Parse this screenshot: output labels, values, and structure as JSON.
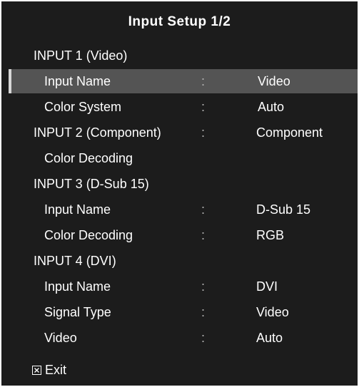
{
  "title": "Input Setup 1/2",
  "colon": ":",
  "rows": [
    {
      "label": "INPUT 1 (Video)",
      "value": ""
    },
    {
      "label": "Input Name",
      "value": "Video"
    },
    {
      "label": "Color System",
      "value": "Auto"
    },
    {
      "label": "INPUT 2 (Component)",
      "value": "Component"
    },
    {
      "label": "Color Decoding",
      "value": ""
    },
    {
      "label": "INPUT 3 (D-Sub 15)",
      "value": ""
    },
    {
      "label": "Input Name",
      "value": "D-Sub 15"
    },
    {
      "label": "Color Decoding",
      "value": "RGB"
    },
    {
      "label": "INPUT 4 (DVI)",
      "value": ""
    },
    {
      "label": "Input Name",
      "value": "DVI"
    },
    {
      "label": "Signal Type",
      "value": "Video"
    },
    {
      "label": "Video",
      "value": "Auto"
    }
  ],
  "exit": {
    "label": "Exit",
    "icon": "close-box-icon"
  },
  "colors": {
    "background": "#1c1c1c",
    "highlight": "#545454",
    "text": "#ffffff"
  }
}
